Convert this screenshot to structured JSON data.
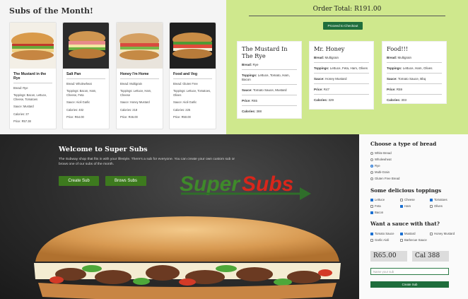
{
  "month": {
    "title": "Subs of the Month!",
    "cards": [
      {
        "name": "The Mustard in the Rye",
        "bread": "Bread: Rye",
        "toppings": "Toppings: Bacon, Lettuce, Cheese, Tomatoes",
        "sauce": "Sauce: Mustard",
        "calories": "Calories: 3?",
        "price": "Price: R57.38"
      },
      {
        "name": "Salt Pan",
        "bread": "Bread: Wholewheat",
        "toppings": "Toppings: Bacon, Ham, Cheese, Feta",
        "sauce": "Sauce: Aioli Garlic",
        "calories": "Calories: 402",
        "price": "Price: R64.00"
      },
      {
        "name": "Honey I'm Home",
        "bread": "Bread: Multigrain",
        "toppings": "Toppings: Lettuce, Ham, Cheese",
        "sauce": "Sauce: Honey Mustard",
        "calories": "Calories: 218",
        "price": "Price: R46.00"
      },
      {
        "name": "Food and Veg",
        "bread": "Bread: Gluten Free",
        "toppings": "Toppings: Lettuce, Tomatoes, Olives",
        "sauce": "Sauce: Aioli Garlic",
        "calories": "Calories: 225",
        "price": "Price: R50.00"
      }
    ]
  },
  "order": {
    "total": "Order Total: R191.00",
    "checkout_label": "Proceed to Checkout",
    "items": [
      {
        "name": "The Mustard In The Rye",
        "bread": "Rye",
        "toppings": "Lettuce, Tomato, Ham, Bacon",
        "sauce": "Tomato Sauce, Mustard",
        "price": "R65",
        "calories": "388"
      },
      {
        "name": "Mr. Honey",
        "bread": "Multigrain",
        "toppings": "Lettuce, Feta, Ham, Olives",
        "sauce": "Honey Mustard",
        "price": "R47",
        "calories": "329"
      },
      {
        "name": "Food!!!",
        "bread": "Multigrain",
        "toppings": "Lettuce, Ham, Olives",
        "sauce": "Tomato Sauce, Bbq",
        "price": "R59",
        "calories": "303"
      }
    ],
    "labels": {
      "bread": "Bread:",
      "toppings": "Toppings:",
      "sauce": "Sauce:",
      "price": "Price:",
      "calories": "Calories:"
    }
  },
  "hero": {
    "title": "Welcome to Super Subs",
    "description": "The Subway shop that fits in with your lifestyle. There's a sub for everyone. You can create your own custom sub or brows one of our subs of the month.",
    "create_label": "Create Sub",
    "browse_label": "Brows Subs",
    "logo_super": "Super",
    "logo_subs": "Subs",
    "colors": {
      "logo_green": "#3e8a2a",
      "logo_red": "#d8261b",
      "button_green": "#3d7a1e"
    }
  },
  "builder": {
    "bread_heading": "Choose a type of bread",
    "breads": [
      {
        "label": "White Bread",
        "selected": false
      },
      {
        "label": "Wholewheat",
        "selected": false
      },
      {
        "label": "Rye",
        "selected": true
      },
      {
        "label": "Multi-Grain",
        "selected": false
      },
      {
        "label": "Gluten Free Bread",
        "selected": false
      }
    ],
    "toppings_heading": "Some delicious toppings",
    "toppings": [
      {
        "label": "Lettuce",
        "checked": true
      },
      {
        "label": "Cheese",
        "checked": false
      },
      {
        "label": "Tomatoes",
        "checked": true
      },
      {
        "label": "Feta",
        "checked": false
      },
      {
        "label": "Ham",
        "checked": true
      },
      {
        "label": "Olives",
        "checked": false
      },
      {
        "label": "Bacon",
        "checked": true
      }
    ],
    "sauce_heading": "Want a sauce with that?",
    "sauces": [
      {
        "label": "Tomato Sauce",
        "checked": true
      },
      {
        "label": "Mustard",
        "checked": true
      },
      {
        "label": "Honey Mustard",
        "checked": false
      },
      {
        "label": "Garlic Aioli",
        "checked": false
      },
      {
        "label": "Barbecue Sauce",
        "checked": false
      }
    ],
    "price": "R65.00",
    "calories": "Cal 388",
    "name_placeholder": "Name your sub",
    "create_label": "Create Sub",
    "colors": {
      "accent_green": "#1f6e3c",
      "check_blue": "#1a6fd1"
    }
  }
}
